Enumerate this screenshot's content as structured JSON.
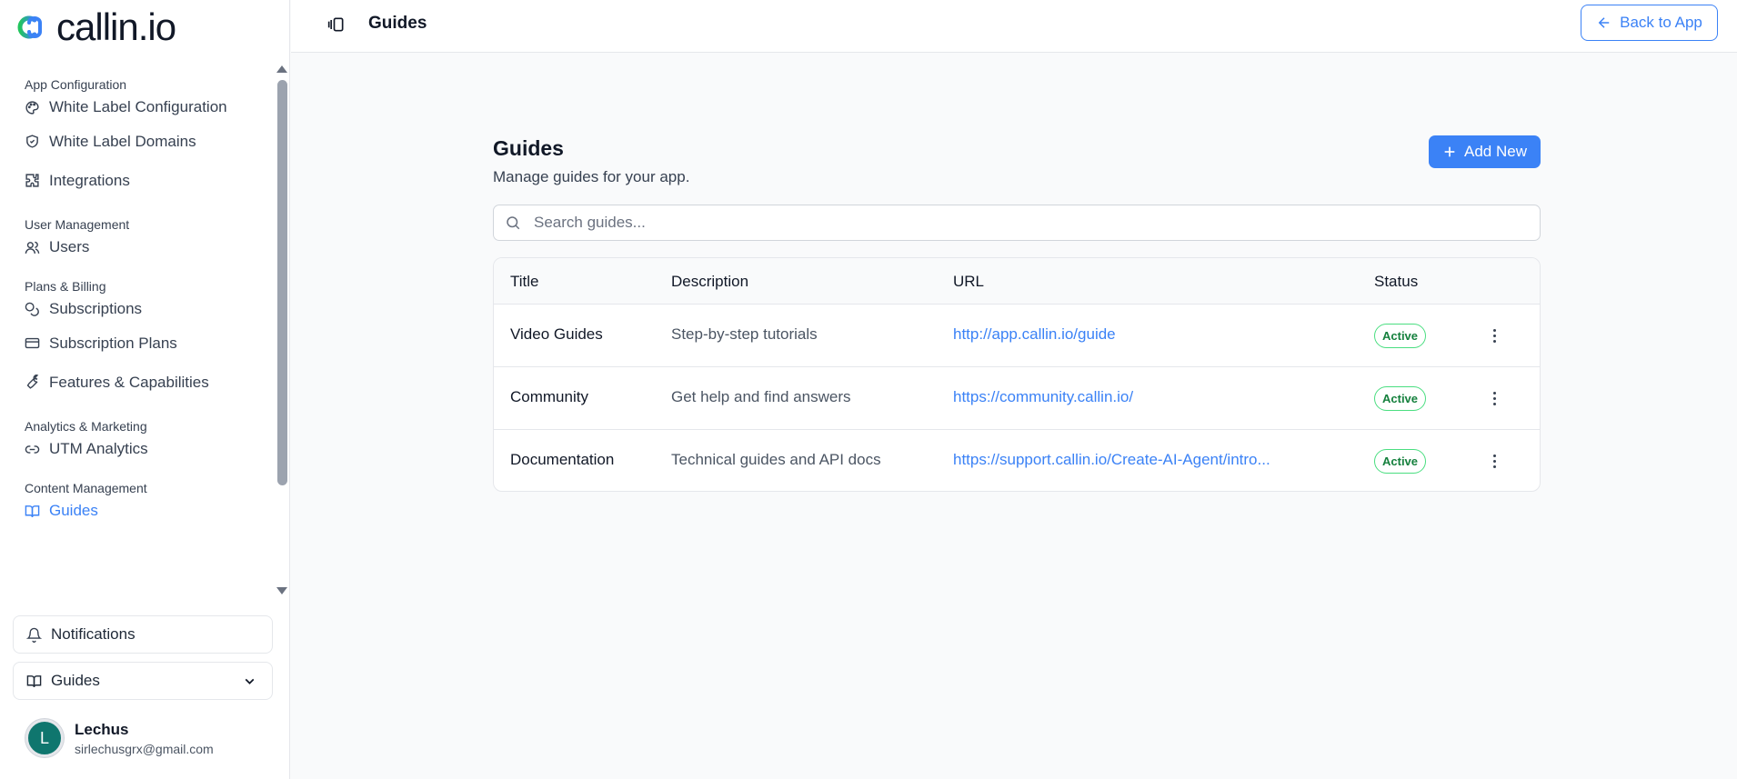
{
  "app": {
    "brand": "callin.io"
  },
  "header": {
    "title": "Guides",
    "back_label": "Back to App"
  },
  "sidebar": {
    "groups": [
      {
        "title": "App Configuration",
        "items": [
          {
            "label": "White Label Configuration",
            "icon": "palette-icon"
          },
          {
            "label": "White Label Domains",
            "icon": "shield-icon"
          },
          {
            "label": "Integrations",
            "icon": "puzzle-icon"
          }
        ]
      },
      {
        "title": "User Management",
        "items": [
          {
            "label": "Users",
            "icon": "users-icon"
          }
        ]
      },
      {
        "title": "Plans & Billing",
        "items": [
          {
            "label": "Subscriptions",
            "icon": "coins-icon"
          },
          {
            "label": "Subscription Plans",
            "icon": "credit-card-icon"
          },
          {
            "label": "Features & Capabilities",
            "icon": "wrench-icon"
          }
        ]
      },
      {
        "title": "Analytics & Marketing",
        "items": [
          {
            "label": "UTM Analytics",
            "icon": "link-icon"
          }
        ]
      },
      {
        "title": "Content Management",
        "items": [
          {
            "label": "Guides",
            "icon": "book-icon",
            "active": true
          }
        ]
      }
    ],
    "notifications_label": "Notifications",
    "guides_dropdown_label": "Guides",
    "user": {
      "initial": "L",
      "name": "Lechus",
      "email": "sirlechusgrx@gmail.com"
    }
  },
  "main": {
    "title": "Guides",
    "subtitle": "Manage guides for your app.",
    "add_label": "Add New",
    "search_placeholder": "Search guides...",
    "columns": [
      "Title",
      "Description",
      "URL",
      "Status"
    ],
    "rows": [
      {
        "title": "Video Guides",
        "description": "Step-by-step tutorials",
        "url": "http://app.callin.io/guide",
        "status": "Active"
      },
      {
        "title": "Community",
        "description": "Get help and find answers",
        "url": "https://community.callin.io/",
        "status": "Active"
      },
      {
        "title": "Documentation",
        "description": "Technical guides and API docs",
        "url": "https://support.callin.io/Create-AI-Agent/intro...",
        "status": "Active"
      }
    ]
  },
  "colors": {
    "accent": "#3b82f6",
    "status_active": "#15803d",
    "avatar": "#0f766e"
  }
}
